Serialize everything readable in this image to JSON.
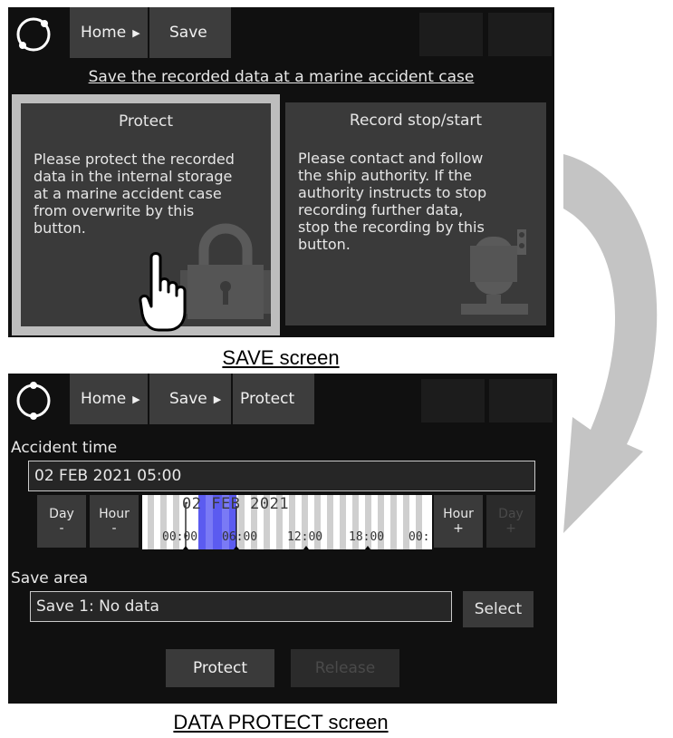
{
  "save_screen": {
    "nav": {
      "home_label": "Home",
      "save_label": "Save"
    },
    "instruction": "Save the recorded data at a marine accident case",
    "protect_button": {
      "title": "Protect",
      "text_lines": [
        "Please protect the recorded",
        "data in the internal storage",
        "at a marine accident case",
        "from overwrite by this",
        "button."
      ]
    },
    "record_button": {
      "title": "Record stop/start",
      "text_lines": [
        "Please contact and follow",
        "the ship authority. If the",
        "authority instructs to stop",
        "recording further data,",
        "stop the recording by this",
        "button."
      ]
    },
    "caption": "SAVE screen"
  },
  "protect_screen": {
    "nav": {
      "home_label": "Home",
      "save_label": "Save",
      "protect_label": "Protect"
    },
    "accident_time_label": "Accident time",
    "accident_time_value": "02 FEB 2021 05:00",
    "day_minus": [
      "Day",
      "-"
    ],
    "hour_minus": [
      "Hour",
      "-"
    ],
    "hour_plus": [
      "Hour",
      "+"
    ],
    "day_plus": [
      "Day",
      "+"
    ],
    "timeline": {
      "date_label": "02 FEB 2021",
      "ticks": [
        "00:00",
        "06:00",
        "12:00",
        "18:00",
        "00:"
      ]
    },
    "save_area_label": "Save area",
    "save_area_value": "Save 1: No data",
    "select_label": "Select",
    "protect_label": "Protect",
    "release_label": "Release",
    "caption": "DATA PROTECT screen"
  },
  "colors": {
    "panel_bg": "#101010",
    "button_bg": "#3a3a3a",
    "highlight_frame": "#bdbdbd",
    "timeline_selection": "#5b5bf0"
  },
  "icons": [
    "logo-ring-icon",
    "chevron-right-icon",
    "lock-icon",
    "hand-pointer-icon",
    "recorder-icon",
    "curved-arrow-icon"
  ]
}
